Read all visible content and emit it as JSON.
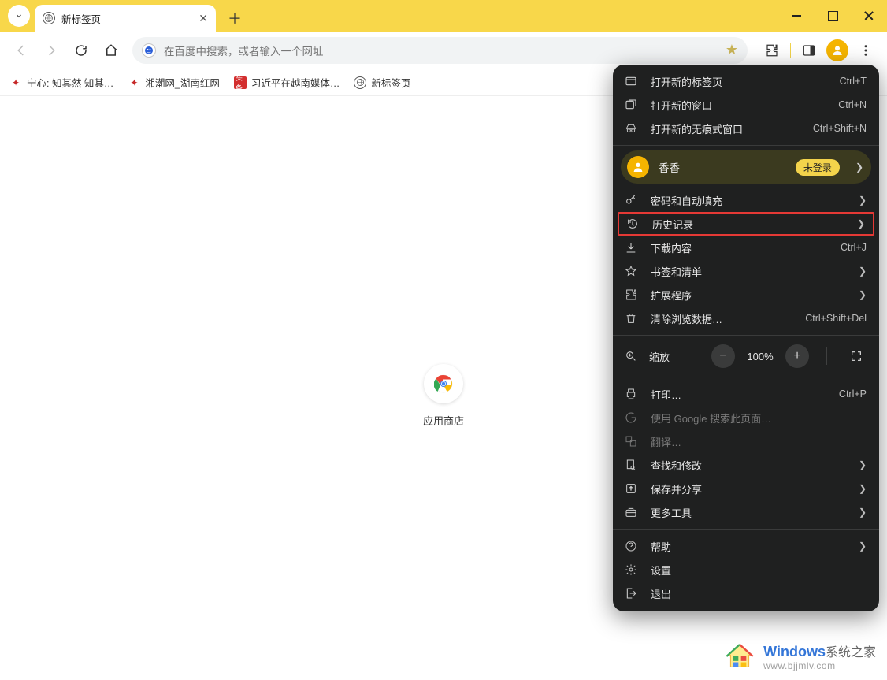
{
  "tab": {
    "title": "新标签页"
  },
  "omnibox": {
    "placeholder": "在百度中搜索，或者输入一个网址"
  },
  "bookmarks": [
    {
      "label": "宁心: 知其然 知其…",
      "iconClass": "red"
    },
    {
      "label": "湘潮网_湖南红网",
      "iconClass": "red"
    },
    {
      "label": "习近平在越南媒体…",
      "iconClass": "badge",
      "badge": "头条"
    },
    {
      "label": "新标签页",
      "iconClass": "globe"
    }
  ],
  "content": {
    "storeLabel": "应用商店"
  },
  "menu": {
    "newTab": {
      "label": "打开新的标签页",
      "accel": "Ctrl+T"
    },
    "newWindow": {
      "label": "打开新的窗口",
      "accel": "Ctrl+N"
    },
    "newIncognito": {
      "label": "打开新的无痕式窗口",
      "accel": "Ctrl+Shift+N"
    },
    "profile": {
      "name": "香香",
      "status": "未登录"
    },
    "passwords": {
      "label": "密码和自动填充"
    },
    "history": {
      "label": "历史记录"
    },
    "downloads": {
      "label": "下载内容",
      "accel": "Ctrl+J"
    },
    "bookmarksList": {
      "label": "书签和清单"
    },
    "extensions": {
      "label": "扩展程序"
    },
    "clearData": {
      "label": "清除浏览数据…",
      "accel": "Ctrl+Shift+Del"
    },
    "zoom": {
      "label": "缩放",
      "value": "100%"
    },
    "print": {
      "label": "打印…",
      "accel": "Ctrl+P"
    },
    "searchPage": {
      "label": "使用 Google 搜索此页面…"
    },
    "translate": {
      "label": "翻译…"
    },
    "findEdit": {
      "label": "查找和修改"
    },
    "saveShare": {
      "label": "保存并分享"
    },
    "moreTools": {
      "label": "更多工具"
    },
    "help": {
      "label": "帮助"
    },
    "settings": {
      "label": "设置"
    },
    "exit": {
      "label": "退出"
    }
  },
  "watermark": {
    "brand1": "Windows",
    "brand2": "系统之家",
    "url": "www.bjjmlv.com"
  }
}
